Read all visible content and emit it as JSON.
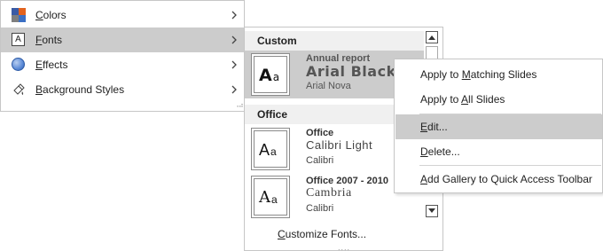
{
  "main_menu": {
    "items": [
      {
        "label": "Colors",
        "underline": "C",
        "icon": "colors-icon"
      },
      {
        "label": "Fonts",
        "underline": "F",
        "icon": "fonts-icon"
      },
      {
        "label": "Effects",
        "underline": "E",
        "icon": "effects-icon"
      },
      {
        "label": "Background Styles",
        "underline": "B",
        "icon": "background-styles-icon"
      }
    ]
  },
  "gallery": {
    "sections": {
      "custom": "Custom",
      "office": "Office"
    },
    "preview_big": "A",
    "preview_small": "a",
    "items": [
      {
        "title": "Annual report",
        "heading": "Arial Black",
        "body": "Arial Nova"
      },
      {
        "title": "Office",
        "heading": "Calibri Light",
        "body": "Calibri"
      },
      {
        "title": "Office 2007 - 2010",
        "heading": "Cambria",
        "body": "Calibri"
      }
    ],
    "customize_pre": "",
    "customize_u": "C",
    "customize_rest": "ustomize Fonts...",
    "dots": "....",
    "scroll_up": "▲",
    "scroll_down": "▼"
  },
  "context_menu": {
    "items": [
      {
        "pre": "Apply to ",
        "u": "M",
        "rest": "atching Slides"
      },
      {
        "pre": "Apply to ",
        "u": "A",
        "rest": "ll Slides"
      },
      {
        "pre": "",
        "u": "E",
        "rest": "dit..."
      },
      {
        "pre": "",
        "u": "D",
        "rest": "elete..."
      },
      {
        "pre": "",
        "u": "A",
        "rest": "dd Gallery to Quick Access Toolbar"
      }
    ]
  },
  "colors": {
    "hover_bg": "#cccccc",
    "menu_border": "#c6c6c6",
    "section_bg": "#f0f0f0"
  }
}
